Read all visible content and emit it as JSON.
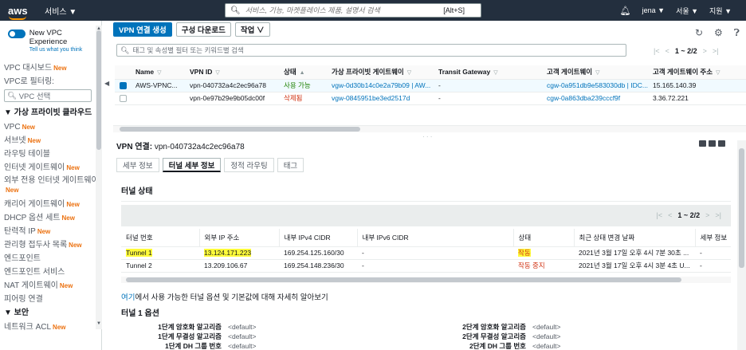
{
  "topnav": {
    "logo": "aws",
    "services": "서비스 ▼",
    "search_placeholder": "서비스, 기능, 마켓플레이스 제품, 설명서 검색",
    "search_shortcut": "[Alt+S]",
    "user": "jena ▼",
    "region": "서울 ▼",
    "support": "지원 ▼"
  },
  "sidebar": {
    "toggle_title": "New VPC Experience",
    "toggle_sub": "Tell us what you think",
    "dashboard": "VPC 대시보드",
    "filter_label": "VPC로 필터링:",
    "filter_placeholder": "VPC 선택",
    "section_vpc": "▼ 가상 프라이빗 클라우드",
    "items": [
      {
        "label": "VPC",
        "new": "New"
      },
      {
        "label": "서브넷",
        "new": "New"
      },
      {
        "label": "라우팅 테이블",
        "new": ""
      },
      {
        "label": "인터넷 게이트웨이",
        "new": "New"
      },
      {
        "label": "외부 전용 인터넷 게이트웨이",
        "new": "New"
      },
      {
        "label": "캐리어 게이트웨이",
        "new": "New"
      },
      {
        "label": "DHCP 옵션 세트",
        "new": "New"
      },
      {
        "label": "탄력적 IP",
        "new": "New"
      },
      {
        "label": "관리형 접두사 목록",
        "new": "New"
      },
      {
        "label": "엔드포인트",
        "new": ""
      },
      {
        "label": "엔드포인트 서비스",
        "new": ""
      },
      {
        "label": "NAT 게이트웨이",
        "new": "New"
      },
      {
        "label": "피어링 연결",
        "new": ""
      }
    ],
    "section_security": "▼ 보안",
    "security_items": [
      {
        "label": "네트워크 ACL",
        "new": "New"
      }
    ],
    "new_badge": "New"
  },
  "toolbar": {
    "create": "VPN 연결 생성",
    "download": "구성 다운로드",
    "actions": "작업 ∨"
  },
  "filter": {
    "placeholder": "태그 및 속성별 필터 또는 키워드별 검색"
  },
  "pager": {
    "range": "1 ~ 2/2"
  },
  "connections": {
    "headers": [
      "Name",
      "VPN ID",
      "상태",
      "가상 프라이빗 게이트웨이",
      "Transit Gateway",
      "고객 게이트웨이",
      "고객 게이트웨이 주소"
    ],
    "rows": [
      {
        "name": "AWS-VPNC...",
        "vpn_id": "vpn-040732a4c2ec96a78",
        "state": "사용 가능",
        "vgw": "vgw-0d30b14c0e2a79b09 | AW...",
        "tgw": "-",
        "cgw": "cgw-0a951db9e583030db | IDC...",
        "cgw_addr": "15.165.140.39"
      },
      {
        "name": "",
        "vpn_id": "vpn-0e97b29e9b05dc00f",
        "state": "삭제됨",
        "vgw": "vgw-0845951be3ed2517d",
        "tgw": "-",
        "cgw": "cgw-0a863dba239cccf9f",
        "cgw_addr": "3.36.72.221"
      }
    ]
  },
  "detail": {
    "label": "VPN 연결:",
    "id": "vpn-040732a4c2ec96a78",
    "tabs": [
      "세부 정보",
      "터널 세부 정보",
      "정적 라우팅",
      "태그"
    ],
    "tunnel_status": "터널 상태",
    "tunnel_pager": "1 ~ 2/2",
    "tunnel_headers": [
      "터널 번호",
      "외부 IP 주소",
      "내부 IPv4 CIDR",
      "내부 IPv6 CIDR",
      "상태",
      "최근 상태 변경 날짜",
      "세부 정보"
    ],
    "tunnels": [
      {
        "num": "Tunnel 1",
        "ip": "13.124.171.223",
        "v4": "169.254.125.160/30",
        "v6": "-",
        "status": "작동",
        "changed": "2021년 3월 17일 오후 4시 7분 30초 ...",
        "details": "-"
      },
      {
        "num": "Tunnel 2",
        "ip": "13.209.106.67",
        "v4": "169.254.148.236/30",
        "v6": "-",
        "status": "작동 중지",
        "changed": "2021년 3월 17일 오후 4시 3분 4초 U...",
        "details": "-"
      }
    ],
    "more_link": "여기",
    "more_text": "에서 사용 가능한 터널 옵션 및 기본값에 대해 자세히 알아보기",
    "options_title": "터널 1 옵션",
    "options_left": [
      {
        "label": "1단계 암호화 알고리즘",
        "value": "<default>"
      },
      {
        "label": "1단계 무결성 알고리즘",
        "value": "<default>"
      },
      {
        "label": "1단계 DH 그룹 번호",
        "value": "<default>"
      }
    ],
    "options_right": [
      {
        "label": "2단계 암호화 알고리즘",
        "value": "<default>"
      },
      {
        "label": "2단계 무결성 알고리즘",
        "value": "<default>"
      },
      {
        "label": "2단계 DH 그룹 번호",
        "value": "<default>"
      }
    ]
  }
}
